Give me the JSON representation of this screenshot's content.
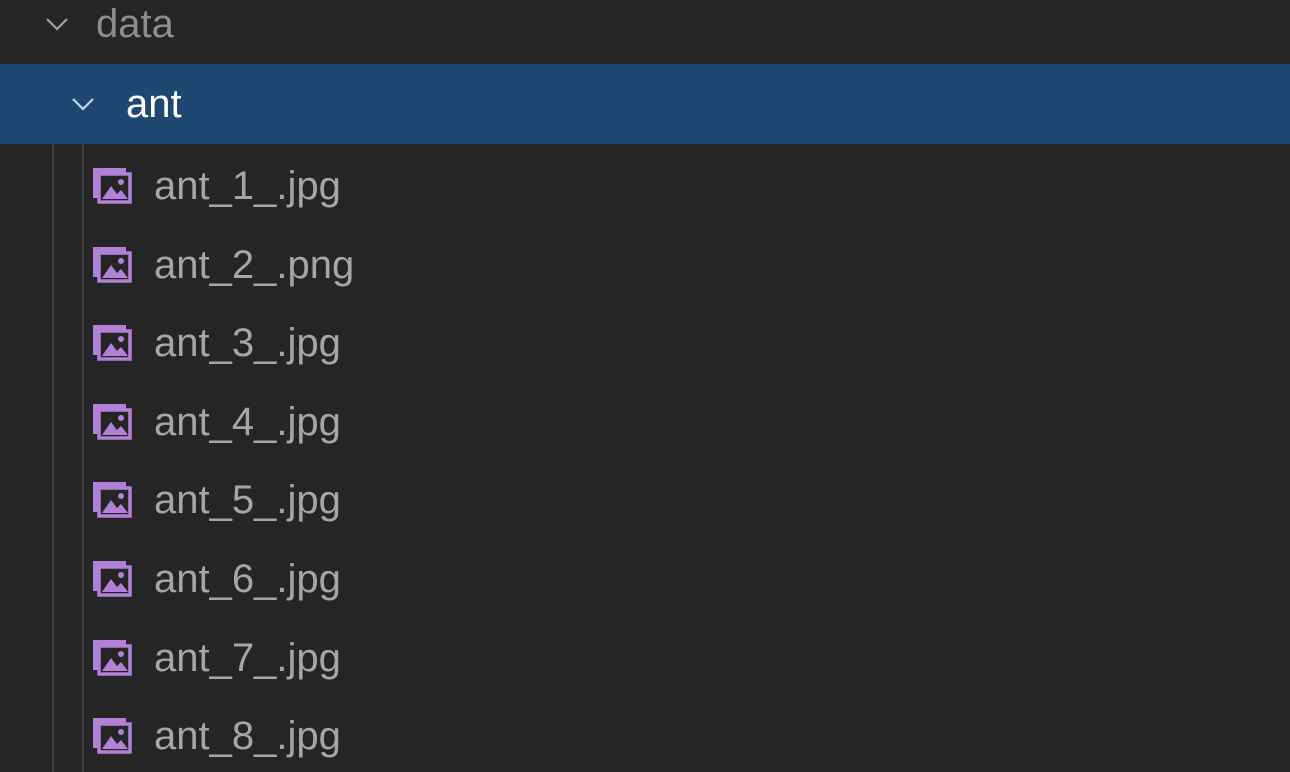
{
  "explorer": {
    "root_folder": {
      "label": "data",
      "expanded": true,
      "icon": "chevron-down-icon"
    },
    "selected_folder": {
      "label": "ant",
      "expanded": true,
      "icon": "chevron-down-icon"
    },
    "files": [
      {
        "label": "ant_1_.jpg",
        "icon": "image-file-icon"
      },
      {
        "label": "ant_2_.png",
        "icon": "image-file-icon"
      },
      {
        "label": "ant_3_.jpg",
        "icon": "image-file-icon"
      },
      {
        "label": "ant_4_.jpg",
        "icon": "image-file-icon"
      },
      {
        "label": "ant_5_.jpg",
        "icon": "image-file-icon"
      },
      {
        "label": "ant_6_.jpg",
        "icon": "image-file-icon"
      },
      {
        "label": "ant_7_.jpg",
        "icon": "image-file-icon"
      },
      {
        "label": "ant_8_.jpg",
        "icon": "image-file-icon"
      }
    ]
  },
  "colors": {
    "background": "#252526",
    "selection": "#1e4872",
    "image_icon": "#b180d7"
  }
}
